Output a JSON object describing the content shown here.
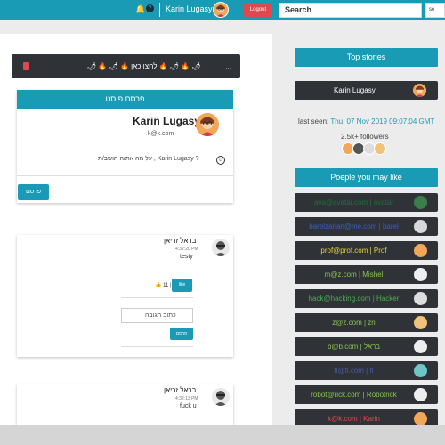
{
  "topbar": {
    "bell_icon": "bell-icon",
    "help_icon": "question-icon",
    "help_glyph": "?",
    "user_name": "Karin Lugasy",
    "logout_label": "Logout",
    "search_placeholder": "Search",
    "search_button_label": "se"
  },
  "notice": {
    "text": "🌶 🔥 🌶 🔥 לחצו כאן 🔥 🌶 🔥 🌶",
    "dots": "..."
  },
  "post_form": {
    "header": "פרסם פוסט",
    "author_name": "Karin Lugasy",
    "author_email": "k@k.com",
    "prompt": "על מה את/ה חושב/ת , Karin Lugasy ?",
    "emoji_glyph": "☺",
    "submit_label": "פרסם"
  },
  "feed": [
    {
      "author": "בראל זריאן",
      "time": "4:32:20 PM",
      "body": "testy",
      "likes": "👍 11 |",
      "like_button": "like",
      "comment_placeholder": "כתוב תגובה",
      "comment_button": "פרסם"
    },
    {
      "author": "בראל זריאן",
      "time": "4:32:13 PM",
      "body": "fuck u"
    }
  ],
  "sidebar": {
    "top_stories_title": "Top stories",
    "story_user": "Karin Lugasy",
    "last_seen_label": "last seen:",
    "last_seen_value": "Thu, 07 Nov 2019 09:07:04 GMT",
    "followers": "2.5k+ followers",
    "people_title": "Poeple you may like",
    "people": [
      {
        "label": "ava@avatar.com | avatar",
        "color": "#1f6f3a"
      },
      {
        "label": "barelzarian@me.com | barel",
        "color": "#3a5fc4"
      },
      {
        "label": "prof@prof.com | Prof",
        "color": "#e8d13a"
      },
      {
        "label": "m@z.com | Mishel",
        "color": "#8bc34a"
      },
      {
        "label": "hack@hacking.com | Hacker",
        "color": "#4caf50"
      },
      {
        "label": "z@z.com | zri",
        "color": "#8bc34a"
      },
      {
        "label": "b@b.com | בראל",
        "color": "#8bc34a"
      },
      {
        "label": "fl@fl.com | fl",
        "color": "#4a5aa8"
      },
      {
        "label": "robot@rick.com | Robotrick",
        "color": "#8bc34a"
      },
      {
        "label": "k@k.com | Karin",
        "color": "#e0484f"
      }
    ]
  }
}
